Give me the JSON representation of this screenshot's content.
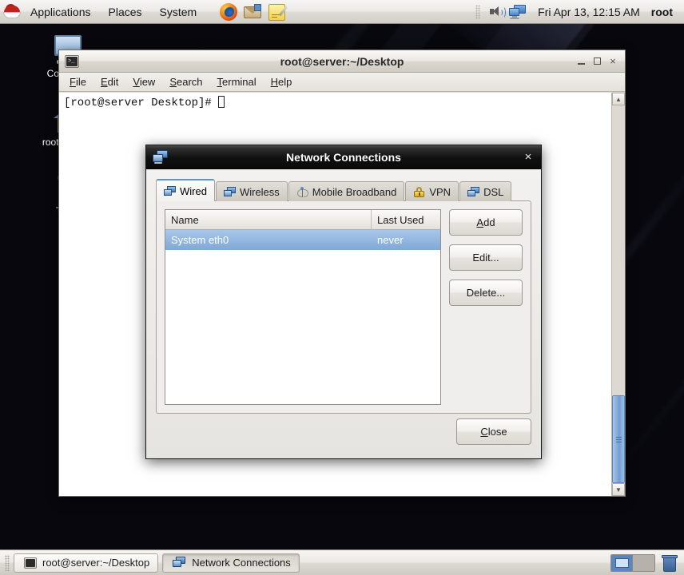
{
  "top_panel": {
    "logo_icon": "redhat-logo-icon",
    "menus": [
      {
        "label": "Applications"
      },
      {
        "label": "Places"
      },
      {
        "label": "System"
      }
    ],
    "launchers": [
      {
        "name": "firefox-icon"
      },
      {
        "name": "evolution-mail-icon"
      },
      {
        "name": "notes-editor-icon"
      }
    ],
    "tray": {
      "volume_icon": "volume-speaker-icon",
      "network_icon": "network-monitors-icon"
    },
    "clock": "Fri Apr 13, 12:15 AM",
    "user": "root"
  },
  "desktop_icons": [
    {
      "label": "Computer",
      "icon": "computer-icon"
    },
    {
      "label": "root's Home",
      "icon": "home-folder-icon"
    },
    {
      "label": "Trash",
      "icon": "trash-icon"
    }
  ],
  "terminal": {
    "title": "root@server:~/Desktop",
    "icon": "terminal-icon",
    "menus": [
      {
        "mnemonic": "F",
        "rest": "ile"
      },
      {
        "mnemonic": "E",
        "rest": "dit"
      },
      {
        "mnemonic": "V",
        "rest": "iew"
      },
      {
        "mnemonic": "S",
        "rest": "earch"
      },
      {
        "mnemonic": "T",
        "rest": "erminal"
      },
      {
        "mnemonic": "H",
        "rest": "elp"
      }
    ],
    "prompt": "[root@server Desktop]# ",
    "controls": {
      "minimize": "minimize-icon",
      "maximize": "maximize-icon",
      "close": "×"
    }
  },
  "network_dialog": {
    "title": "Network Connections",
    "icon": "network-connections-icon",
    "close_label": "×",
    "tabs": [
      {
        "label": "Wired",
        "icon": "wired-monitors-icon",
        "active": true
      },
      {
        "label": "Wireless",
        "icon": "wireless-monitors-icon",
        "active": false
      },
      {
        "label": "Mobile Broadband",
        "icon": "antenna-tower-icon",
        "active": false
      },
      {
        "label": "VPN",
        "icon": "lock-icon",
        "active": false
      },
      {
        "label": "DSL",
        "icon": "dsl-monitors-icon",
        "active": false
      }
    ],
    "columns": [
      "Name",
      "Last Used"
    ],
    "rows": [
      {
        "name": "System eth0",
        "last_used": "never",
        "selected": true
      }
    ],
    "buttons": [
      {
        "label": "Add",
        "mnemonic": "A"
      },
      {
        "label": "Edit...",
        "mnemonic": ""
      },
      {
        "label": "Delete...",
        "mnemonic": ""
      }
    ],
    "close_button": {
      "label": "Close",
      "mnemonic": "C"
    },
    "accent_color": "#5f92cf",
    "selection_color": "#7fa9d8"
  },
  "taskbar": {
    "tasks": [
      {
        "label": "root@server:~/Desktop",
        "icon": "terminal-icon",
        "active": false
      },
      {
        "label": "Network Connections",
        "icon": "network-connections-icon",
        "active": true
      }
    ],
    "workspaces": [
      {
        "active": true
      },
      {
        "active": false
      }
    ],
    "trash_icon": "trash-icon"
  }
}
